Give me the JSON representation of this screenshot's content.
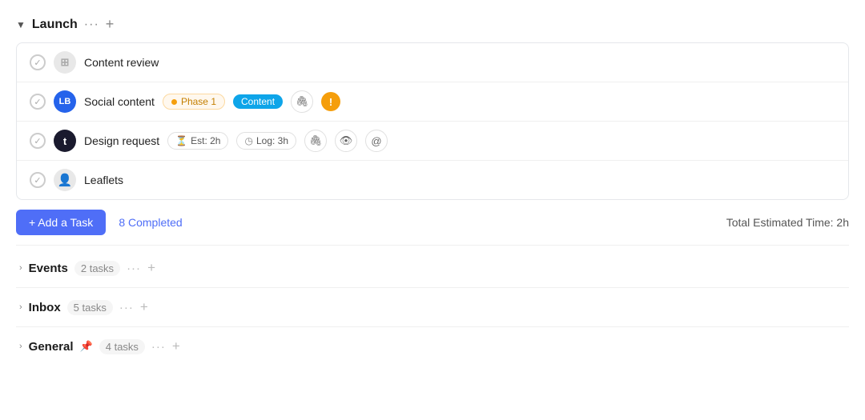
{
  "launch_section": {
    "title": "Launch",
    "chevron": "▼",
    "dots": "···",
    "plus": "+"
  },
  "tasks": [
    {
      "id": "content-review",
      "name": "Content review",
      "avatar_type": "building",
      "avatar_color": "",
      "avatar_initials": ""
    },
    {
      "id": "social-content",
      "name": "Social content",
      "avatar_type": "initials",
      "avatar_color": "#2563eb",
      "avatar_initials": "LB",
      "phase_label": "Phase 1",
      "content_label": "Content",
      "has_attachment": true,
      "has_warning": true
    },
    {
      "id": "design-request",
      "name": "Design request",
      "avatar_type": "initials",
      "avatar_color": "#1a1a2e",
      "avatar_initials": "t",
      "est_label": "Est: 2h",
      "log_label": "Log: 3h",
      "has_attachment": true,
      "has_view": true,
      "has_at": true
    },
    {
      "id": "leaflets",
      "name": "Leaflets",
      "avatar_type": "person",
      "avatar_color": "",
      "avatar_initials": ""
    }
  ],
  "add_task": {
    "label": "+ Add a Task",
    "completed_text": "8 Completed",
    "total_estimated": "Total Estimated Time: 2h"
  },
  "other_sections": [
    {
      "id": "events",
      "title": "Events",
      "task_count": "2 tasks",
      "pinned": false
    },
    {
      "id": "inbox",
      "title": "Inbox",
      "task_count": "5 tasks",
      "pinned": false
    },
    {
      "id": "general",
      "title": "General",
      "task_count": "4 tasks",
      "pinned": true
    }
  ],
  "icons": {
    "chevron_down": "▼",
    "chevron_right": "›",
    "check": "✓",
    "dot": "•",
    "plus": "+",
    "dots": "···",
    "building": "▦",
    "person": "👤",
    "paperclip": "🔗",
    "warning": "!",
    "clock": "◷",
    "hourglass": "⏳",
    "eye": "👁",
    "at": "@",
    "pin": "📌"
  }
}
